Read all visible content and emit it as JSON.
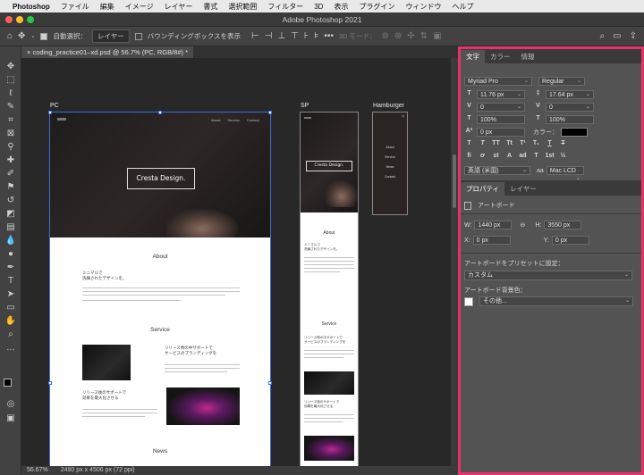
{
  "menubar": {
    "app": "Photoshop",
    "items": [
      "ファイル",
      "編集",
      "イメージ",
      "レイヤー",
      "書式",
      "選択範囲",
      "フィルター",
      "3D",
      "表示",
      "プラグイン",
      "ウィンドウ",
      "ヘルプ"
    ]
  },
  "titlebar": {
    "title": "Adobe Photoshop 2021"
  },
  "options": {
    "auto_select_label": "自動選択：",
    "auto_select_value": "レイヤー",
    "bbox_label": "バウンディングボックスを表示",
    "mode3d_label": "3D モード："
  },
  "document": {
    "tab_title": "coding_practice01–xd.psd @ 56.7% (PC, RGB/8#) *",
    "zoom": "56.67%",
    "size": "2490 px x 4506 px (72 ppi)"
  },
  "artboards": {
    "pc": {
      "label": "PC",
      "nav": [
        "About",
        "Service",
        "Contact"
      ],
      "hero_title": "Cresta Design.",
      "about_heading": "About",
      "about_lead_1": "ミニマルで",
      "about_lead_2": "洗練されたデザインを。",
      "service_heading": "Service",
      "service_1_title_1": "リリース時の中サポートで",
      "service_1_title_2": "サービスのブランディングを",
      "service_2_title_1": "リリース後のサポートで",
      "service_2_title_2": "効果を最大化させる",
      "news_heading": "News"
    },
    "sp": {
      "label": "SP",
      "hero_title": "Cresta Design.",
      "about_heading": "About",
      "about_lead_1": "ミニマルで",
      "about_lead_2": "洗練されたデザインを。",
      "service_heading": "Service",
      "service_1_title_1": "リリース時の中サポートで",
      "service_1_title_2": "サービスのブランディングを",
      "service_2_title_1": "リリース後のサポートで",
      "service_2_title_2": "効果を最大化させる"
    },
    "hamburger": {
      "label": "Hamburger",
      "menu": [
        "About",
        "Service",
        "News",
        "Contact"
      ]
    }
  },
  "char_panel": {
    "tabs": [
      "文字",
      "カラー",
      "情報"
    ],
    "font_family": "Myriad Pro",
    "font_style": "Regular",
    "font_size": "11.76 px",
    "leading": "17.64 px",
    "kerning": "0",
    "tracking": "0",
    "vscale": "100%",
    "hscale": "100%",
    "baseline": "0 px",
    "color_label": "カラー：",
    "language": "英語 (米国)",
    "aa_label": "aa",
    "antialias": "Mac LCD"
  },
  "props_panel": {
    "tabs": [
      "プロパティ",
      "レイヤー"
    ],
    "section": "アートボード",
    "w_label": "W:",
    "w_value": "1440 px",
    "h_label": "H:",
    "h_value": "3550 px",
    "x_label": "X:",
    "x_value": "0 px",
    "y_label": "Y:",
    "y_value": "0 px",
    "preset_label": "アートボードをプリセットに設定：",
    "preset_value": "カスタム",
    "bg_label": "アートボード背景色：",
    "bg_value": "その他..."
  },
  "colors": {
    "accent_highlight": "#e8326a",
    "selection": "#3b6fd8"
  }
}
